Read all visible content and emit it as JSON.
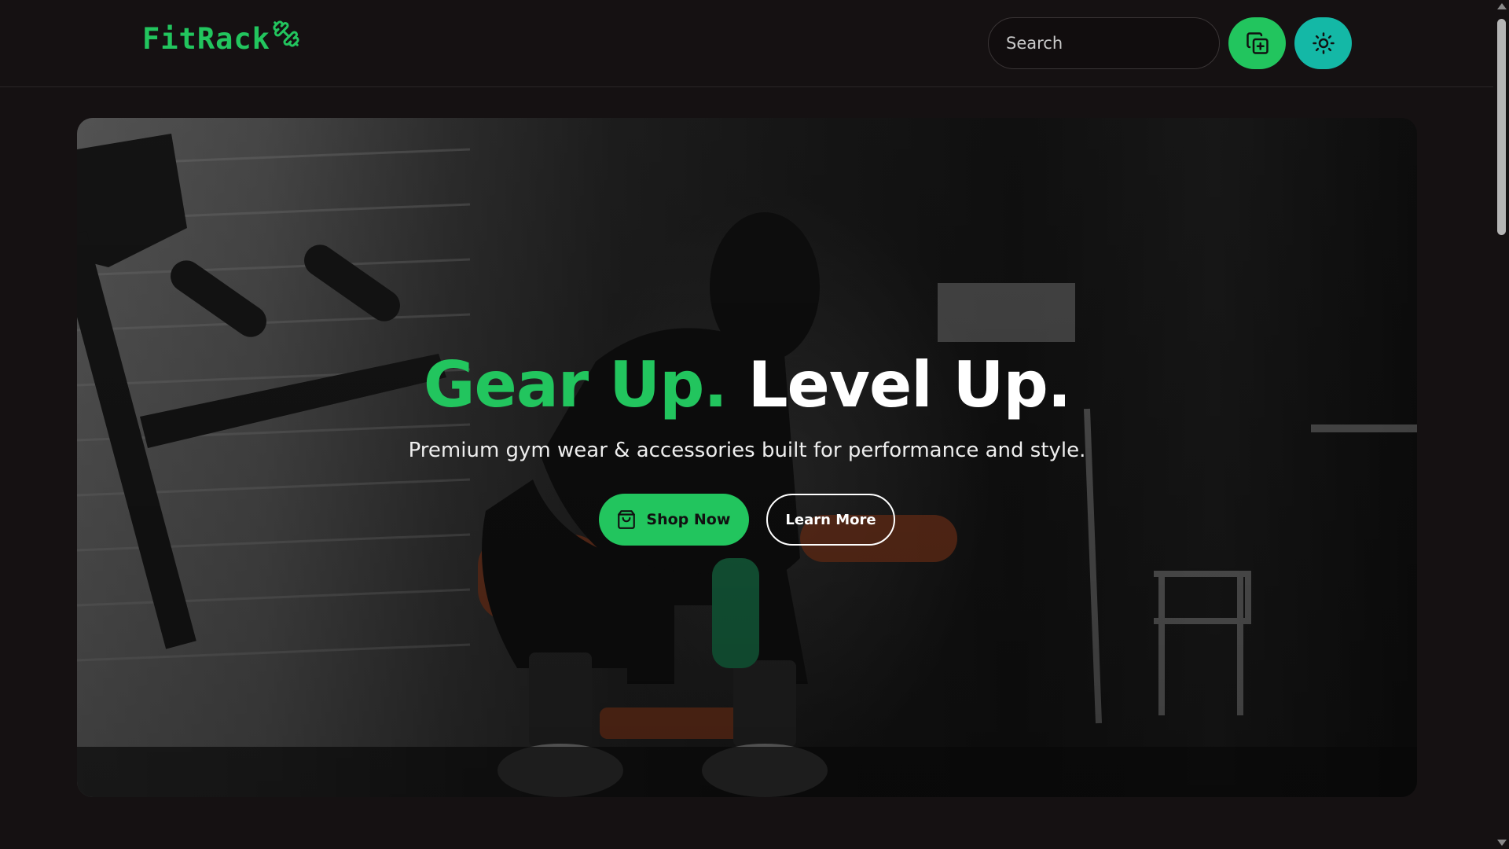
{
  "header": {
    "logo_text": "FitRack",
    "logo_icon": "dumbbell-icon",
    "search_placeholder": "Search",
    "add_button_icon": "copy-plus-icon",
    "theme_button_icon": "sun-icon"
  },
  "hero": {
    "title_accent": "Gear Up.",
    "title_main": "Level Up.",
    "subtitle": "Premium gym wear & accessories built for performance and style.",
    "shop_label": "Shop Now",
    "shop_icon": "shopping-bag-icon",
    "learn_label": "Learn More"
  },
  "colors": {
    "brand_green": "#22c55e",
    "teal": "#14b8a6",
    "background": "#151112"
  }
}
